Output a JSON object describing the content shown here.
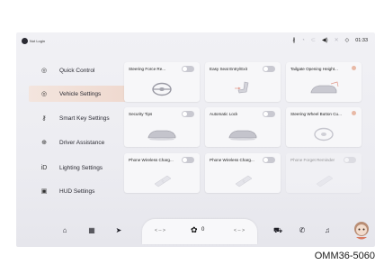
{
  "status": {
    "login_label": "Not Login",
    "clock": "01:33",
    "icons": [
      "bluetooth-icon",
      "signal-icon",
      "wifi-icon",
      "volume-icon",
      "mute-icon",
      "navigation-icon"
    ]
  },
  "menu": {
    "items": [
      {
        "label": "Quick Control",
        "icon": "quick-control-icon",
        "active": false
      },
      {
        "label": "Vehicle Settings",
        "icon": "vehicle-settings-icon",
        "active": true
      },
      {
        "label": "Smart Key Settings",
        "icon": "key-icon",
        "active": false
      },
      {
        "label": "Driver Assistance",
        "icon": "driver-assist-icon",
        "active": false
      },
      {
        "label": "Lighting Settings",
        "icon": "lighting-icon",
        "active": false
      },
      {
        "label": "HUD Settings",
        "icon": "hud-icon",
        "active": false
      }
    ]
  },
  "cards": [
    {
      "title": "Steering Force Re...",
      "control": "toggle",
      "state": "off",
      "art": "steering-wheel"
    },
    {
      "title": "Easy Seat Entry/Exit",
      "control": "toggle",
      "state": "off",
      "art": "seat"
    },
    {
      "title": "Tailgate Opening Height...",
      "control": "dot",
      "art": "car-tailgate"
    },
    {
      "title": "Security Tips",
      "control": "toggle",
      "state": "off",
      "art": "car"
    },
    {
      "title": "Automatic Lock",
      "control": "toggle",
      "state": "off",
      "art": "car"
    },
    {
      "title": "Steering Wheel Button Cu...",
      "control": "dot",
      "art": "steering-wheel"
    },
    {
      "title": "Phone Wireless Charg...",
      "control": "toggle",
      "state": "off",
      "art": "phone"
    },
    {
      "title": "Phone Wireless Charg...",
      "control": "toggle",
      "state": "off",
      "art": "phone"
    },
    {
      "title": "Phone Forget Reminder",
      "control": "toggle",
      "state": "off",
      "art": "phone",
      "faded": true
    }
  ],
  "dock": {
    "climate_left": "< -- >",
    "climate_right": "< -- >",
    "fan_value": "0"
  },
  "figure_code": "OMM36-5060",
  "colors": {
    "active_menu": "#efd9cf",
    "toggle_off": "#c9c9d1",
    "accent_dot": "#e8b9a6"
  }
}
